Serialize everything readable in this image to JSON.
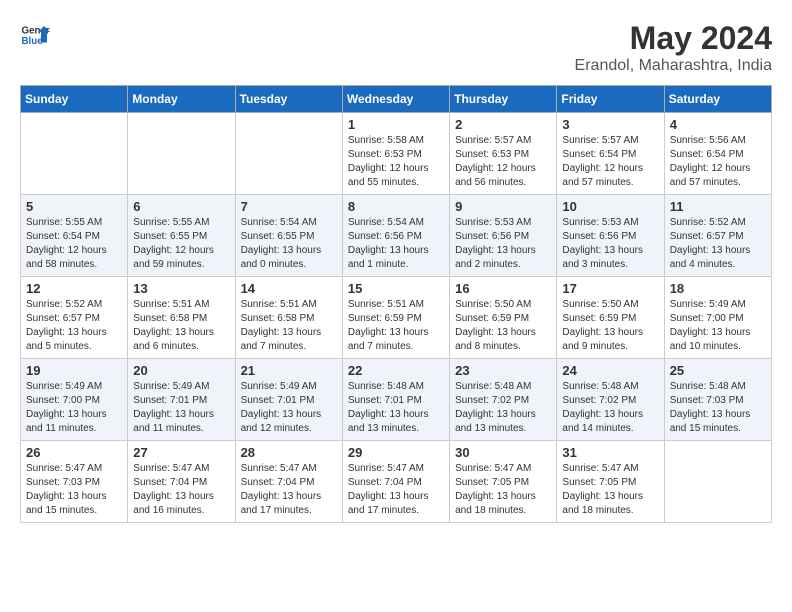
{
  "header": {
    "logo_general": "General",
    "logo_blue": "Blue",
    "title": "May 2024",
    "subtitle": "Erandol, Maharashtra, India"
  },
  "weekdays": [
    "Sunday",
    "Monday",
    "Tuesday",
    "Wednesday",
    "Thursday",
    "Friday",
    "Saturday"
  ],
  "weeks": [
    [
      {
        "day": "",
        "info": ""
      },
      {
        "day": "",
        "info": ""
      },
      {
        "day": "",
        "info": ""
      },
      {
        "day": "1",
        "info": "Sunrise: 5:58 AM\nSunset: 6:53 PM\nDaylight: 12 hours\nand 55 minutes."
      },
      {
        "day": "2",
        "info": "Sunrise: 5:57 AM\nSunset: 6:53 PM\nDaylight: 12 hours\nand 56 minutes."
      },
      {
        "day": "3",
        "info": "Sunrise: 5:57 AM\nSunset: 6:54 PM\nDaylight: 12 hours\nand 57 minutes."
      },
      {
        "day": "4",
        "info": "Sunrise: 5:56 AM\nSunset: 6:54 PM\nDaylight: 12 hours\nand 57 minutes."
      }
    ],
    [
      {
        "day": "5",
        "info": "Sunrise: 5:55 AM\nSunset: 6:54 PM\nDaylight: 12 hours\nand 58 minutes."
      },
      {
        "day": "6",
        "info": "Sunrise: 5:55 AM\nSunset: 6:55 PM\nDaylight: 12 hours\nand 59 minutes."
      },
      {
        "day": "7",
        "info": "Sunrise: 5:54 AM\nSunset: 6:55 PM\nDaylight: 13 hours\nand 0 minutes."
      },
      {
        "day": "8",
        "info": "Sunrise: 5:54 AM\nSunset: 6:56 PM\nDaylight: 13 hours\nand 1 minute."
      },
      {
        "day": "9",
        "info": "Sunrise: 5:53 AM\nSunset: 6:56 PM\nDaylight: 13 hours\nand 2 minutes."
      },
      {
        "day": "10",
        "info": "Sunrise: 5:53 AM\nSunset: 6:56 PM\nDaylight: 13 hours\nand 3 minutes."
      },
      {
        "day": "11",
        "info": "Sunrise: 5:52 AM\nSunset: 6:57 PM\nDaylight: 13 hours\nand 4 minutes."
      }
    ],
    [
      {
        "day": "12",
        "info": "Sunrise: 5:52 AM\nSunset: 6:57 PM\nDaylight: 13 hours\nand 5 minutes."
      },
      {
        "day": "13",
        "info": "Sunrise: 5:51 AM\nSunset: 6:58 PM\nDaylight: 13 hours\nand 6 minutes."
      },
      {
        "day": "14",
        "info": "Sunrise: 5:51 AM\nSunset: 6:58 PM\nDaylight: 13 hours\nand 7 minutes."
      },
      {
        "day": "15",
        "info": "Sunrise: 5:51 AM\nSunset: 6:59 PM\nDaylight: 13 hours\nand 7 minutes."
      },
      {
        "day": "16",
        "info": "Sunrise: 5:50 AM\nSunset: 6:59 PM\nDaylight: 13 hours\nand 8 minutes."
      },
      {
        "day": "17",
        "info": "Sunrise: 5:50 AM\nSunset: 6:59 PM\nDaylight: 13 hours\nand 9 minutes."
      },
      {
        "day": "18",
        "info": "Sunrise: 5:49 AM\nSunset: 7:00 PM\nDaylight: 13 hours\nand 10 minutes."
      }
    ],
    [
      {
        "day": "19",
        "info": "Sunrise: 5:49 AM\nSunset: 7:00 PM\nDaylight: 13 hours\nand 11 minutes."
      },
      {
        "day": "20",
        "info": "Sunrise: 5:49 AM\nSunset: 7:01 PM\nDaylight: 13 hours\nand 11 minutes."
      },
      {
        "day": "21",
        "info": "Sunrise: 5:49 AM\nSunset: 7:01 PM\nDaylight: 13 hours\nand 12 minutes."
      },
      {
        "day": "22",
        "info": "Sunrise: 5:48 AM\nSunset: 7:01 PM\nDaylight: 13 hours\nand 13 minutes."
      },
      {
        "day": "23",
        "info": "Sunrise: 5:48 AM\nSunset: 7:02 PM\nDaylight: 13 hours\nand 13 minutes."
      },
      {
        "day": "24",
        "info": "Sunrise: 5:48 AM\nSunset: 7:02 PM\nDaylight: 13 hours\nand 14 minutes."
      },
      {
        "day": "25",
        "info": "Sunrise: 5:48 AM\nSunset: 7:03 PM\nDaylight: 13 hours\nand 15 minutes."
      }
    ],
    [
      {
        "day": "26",
        "info": "Sunrise: 5:47 AM\nSunset: 7:03 PM\nDaylight: 13 hours\nand 15 minutes."
      },
      {
        "day": "27",
        "info": "Sunrise: 5:47 AM\nSunset: 7:04 PM\nDaylight: 13 hours\nand 16 minutes."
      },
      {
        "day": "28",
        "info": "Sunrise: 5:47 AM\nSunset: 7:04 PM\nDaylight: 13 hours\nand 17 minutes."
      },
      {
        "day": "29",
        "info": "Sunrise: 5:47 AM\nSunset: 7:04 PM\nDaylight: 13 hours\nand 17 minutes."
      },
      {
        "day": "30",
        "info": "Sunrise: 5:47 AM\nSunset: 7:05 PM\nDaylight: 13 hours\nand 18 minutes."
      },
      {
        "day": "31",
        "info": "Sunrise: 5:47 AM\nSunset: 7:05 PM\nDaylight: 13 hours\nand 18 minutes."
      },
      {
        "day": "",
        "info": ""
      }
    ]
  ]
}
